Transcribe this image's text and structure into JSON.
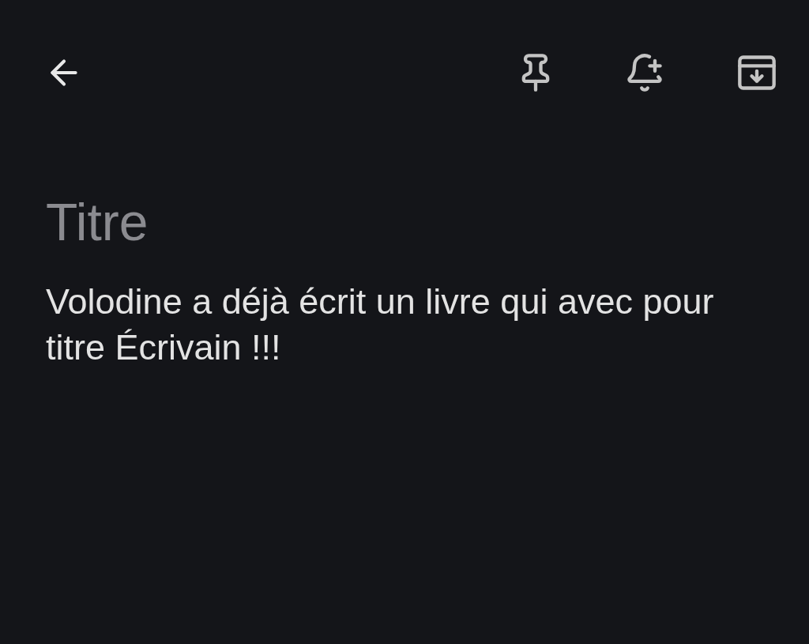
{
  "title": {
    "placeholder": "Titre"
  },
  "body": {
    "value": "Volodine a déjà écrit un livre qui avec pour titre Écrivain !!!"
  }
}
